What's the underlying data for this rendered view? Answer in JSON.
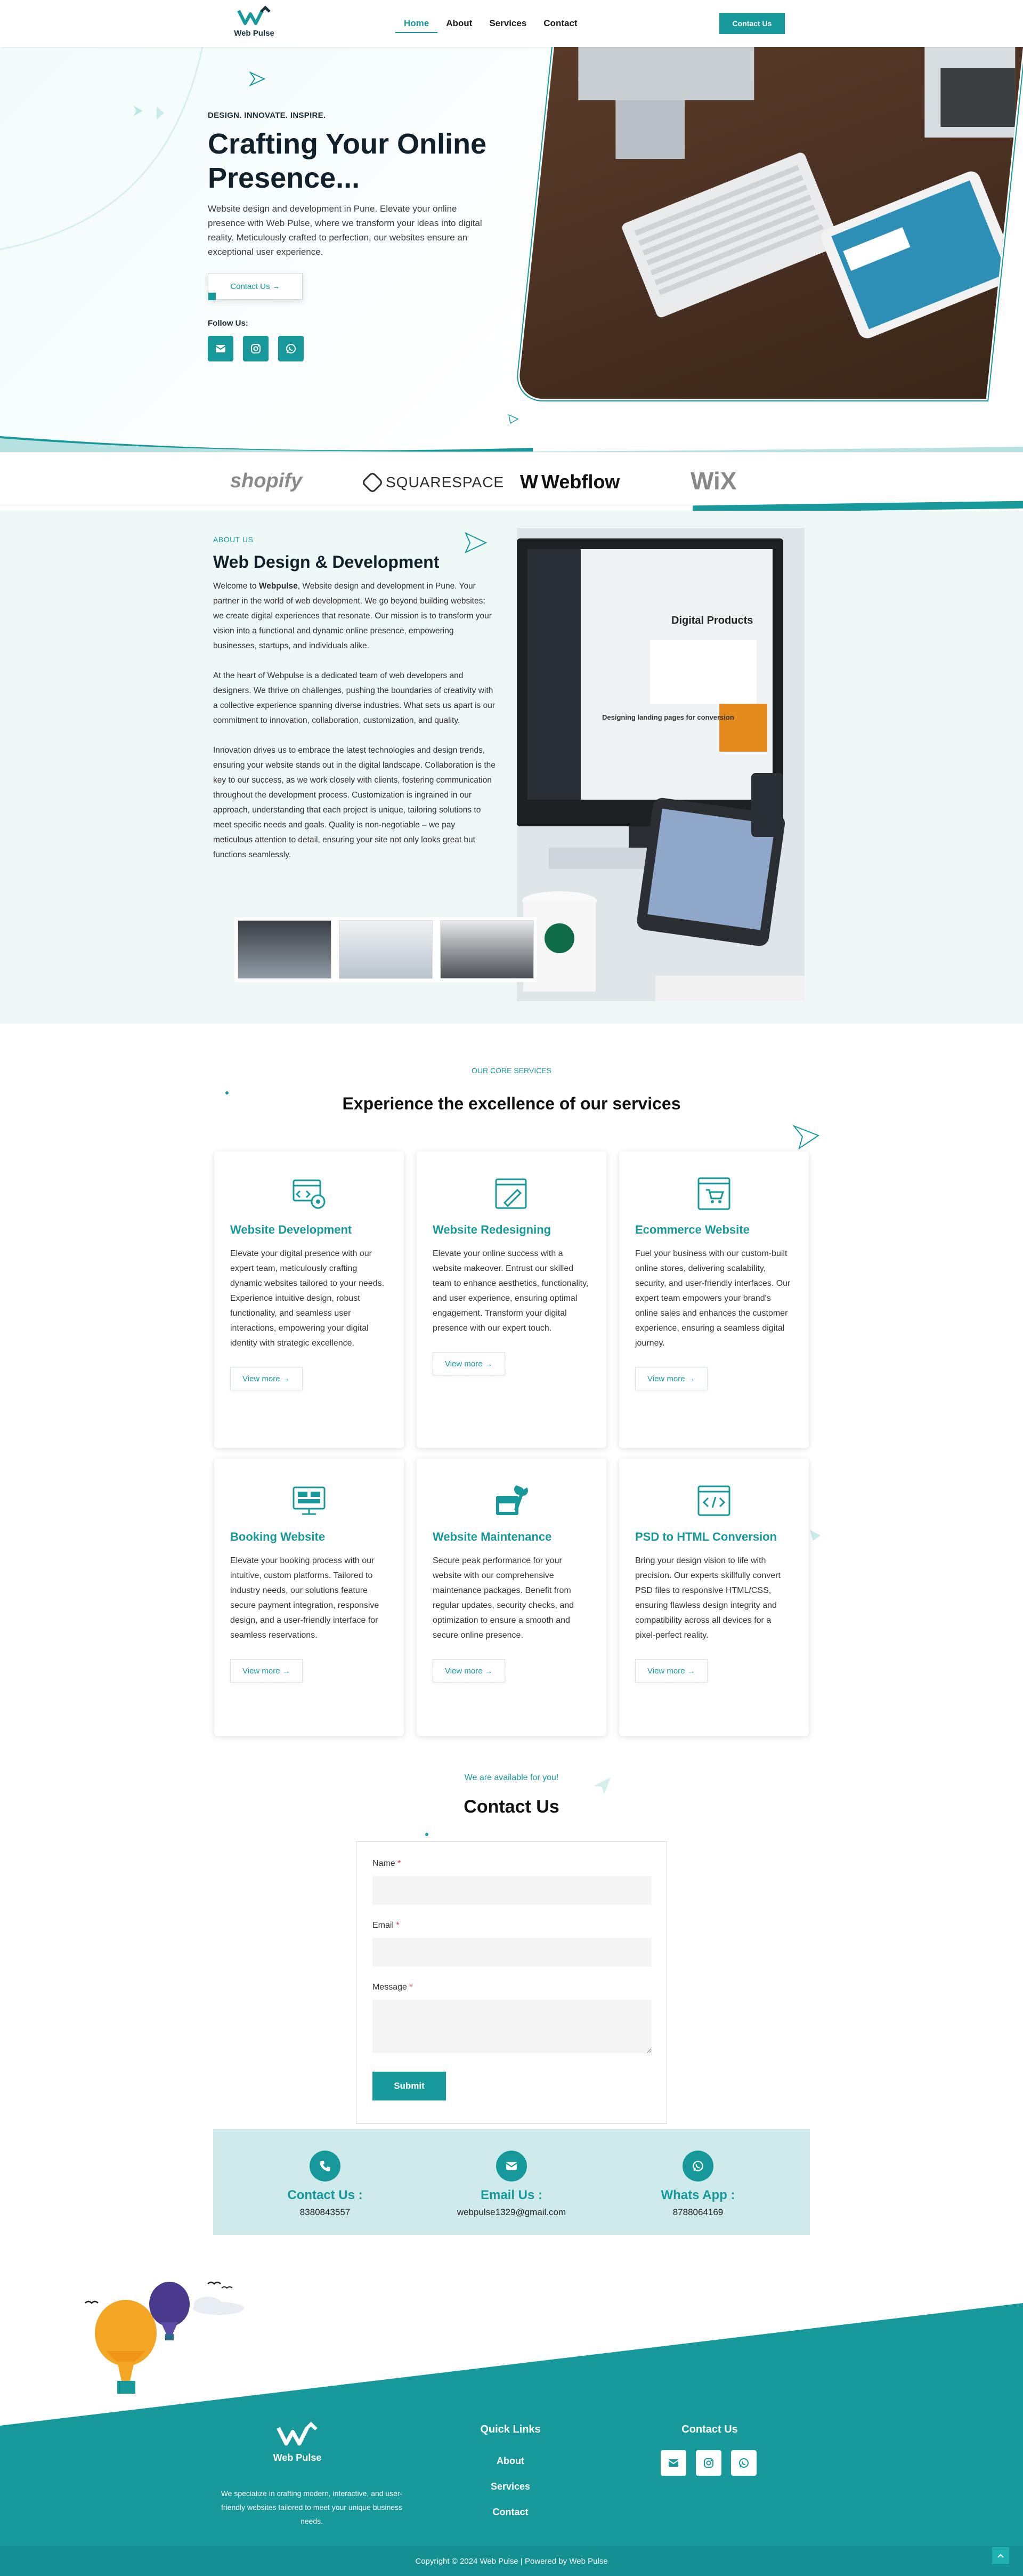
{
  "nav": {
    "logo_text": "Web Pulse",
    "links": [
      "Home",
      "About",
      "Services",
      "Contact"
    ],
    "cta": "Contact Us"
  },
  "hero": {
    "tagline": "DESIGN. INNOVATE. INSPIRE.",
    "title": "Crafting Your Online Presence...",
    "description": "Website design and development in Pune. Elevate your online presence with Web Pulse, where we transform your ideas into digital reality. Meticulously crafted to perfection, our websites ensure an exceptional user experience.",
    "button": "Contact Us →",
    "follow": "Follow Us:"
  },
  "brands": [
    "shopify",
    "SQUARESPACE",
    "Webflow",
    "WiX"
  ],
  "about": {
    "label": "ABOUT US",
    "title": "Web Design  &  Development",
    "p1_prefix": "Welcome to ",
    "p1_bold": "Webpulse",
    "p1_rest": ", Website design and development in Pune. Your partner in the world of web development. We go beyond building websites; we create digital experiences that resonate. Our mission is to transform your vision into a functional and dynamic online presence, empowering businesses, startups, and individuals alike.",
    "p2": "At the heart of Webpulse is a dedicated team of web developers and designers. We thrive on challenges, pushing the boundaries of creativity with a collective experience spanning diverse industries. What sets us apart is our commitment to innovation, collaboration, customization, and quality.",
    "p3": "Innovation drives us to embrace the latest technologies and design trends, ensuring your website stands out in the digital landscape. Collaboration is the key to our success, as we work closely with clients, fostering communication throughout the development process. Customization is ingrained in our approach, understanding that each project is unique, tailoring solutions to meet specific needs and goals. Quality is non-negotiable – we pay meticulous attention to detail, ensuring your site not only looks great but functions seamlessly.",
    "image_text_1": "Digital Products",
    "image_text_2": "Designing landing pages for conversion"
  },
  "services": {
    "label": "OUR CORE SERVICES",
    "title": "Experience the  excellence  of our services",
    "view_more": "View more",
    "items": [
      {
        "title": "Website Development",
        "icon": "code-window-icon",
        "text": "Elevate your digital presence with our expert team, meticulously crafting dynamic websites tailored to your needs. Experience intuitive design, robust functionality, and seamless user interactions, empowering your digital identity with strategic excellence."
      },
      {
        "title": "Website Redesigning",
        "icon": "redesign-brush-icon",
        "text": "Elevate your online success with a website makeover. Entrust our skilled team to enhance aesthetics, functionality, and user experience, ensuring optimal engagement. Transform your digital presence with our expert touch."
      },
      {
        "title": "Ecommerce Website",
        "icon": "shop-cart-icon",
        "text": "Fuel your business with our custom-built online stores, delivering scalability, security, and user-friendly interfaces. Our expert team empowers your brand's online sales and enhances the customer experience, ensuring a seamless digital journey."
      },
      {
        "title": "Booking Website",
        "icon": "booking-monitor-icon",
        "text": "Elevate your booking process with our intuitive, custom platforms. Tailored to industry needs, our solutions feature secure payment integration, responsive design, and a user-friendly interface for seamless reservations."
      },
      {
        "title": "Website Maintenance",
        "icon": "wrench-icon",
        "text": "Secure peak performance for your website with our comprehensive maintenance packages. Benefit from regular updates, security checks, and optimization to ensure a smooth and secure online presence."
      },
      {
        "title": "PSD to HTML Conversion",
        "icon": "html-code-icon",
        "text": "Bring your design vision to life with precision. Our experts skillfully convert PSD files to responsive HTML/CSS, ensuring flawless design integrity and compatibility across all devices for a pixel-perfect reality."
      }
    ]
  },
  "contact": {
    "label": "We are available for you!",
    "title": "Contact  Us",
    "name_label": "Name",
    "email_label": "Email",
    "message_label": "Message",
    "required": "*",
    "submit": "Submit",
    "info": [
      {
        "title": "Contact Us :",
        "value": "8380843557"
      },
      {
        "title": "Email Us :",
        "value": "webpulse1329@gmail.com"
      },
      {
        "title": "Whats App :",
        "value": "8788064169"
      }
    ]
  },
  "footer": {
    "logo_text": "Web Pulse",
    "description": "We specialize in crafting modern, interactive, and user-friendly websites tailored to meet your unique business needs.",
    "quick_links_title": "Quick Links",
    "quick_links": [
      "About",
      "Services",
      "Contact"
    ],
    "contact_title": "Contact Us",
    "copyright": "Copyright © 2024 Web Pulse | Powered by Web Pulse"
  },
  "colors": {
    "accent": "#17999b",
    "light_accent": "#cfeaea",
    "footer": "#17999b"
  }
}
